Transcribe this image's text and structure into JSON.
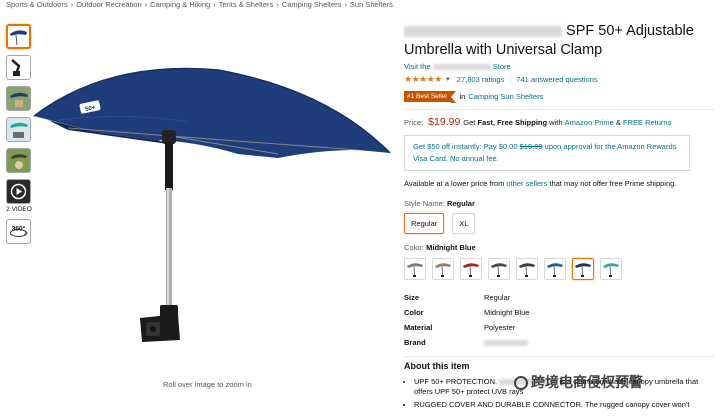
{
  "breadcrumb": [
    "Sports & Outdoors",
    "Outdoor Recreation",
    "Camping & Hiking",
    "Tents & Shelters",
    "Camping Shelters",
    "Sun Shelters"
  ],
  "breadcrumb_sep": "›",
  "thumbnails": {
    "video_label": "2 VIDEO",
    "spin_label": "360°"
  },
  "main_image": {
    "roll_over": "Roll over image to zoom in",
    "badge": "50+"
  },
  "product": {
    "title_visible": "SPF 50+ Adjustable Umbrella with Universal Clamp",
    "store_prefix": "Visit the",
    "store_suffix": "Store",
    "stars": "★★★★★",
    "ratings": "27,803 ratings",
    "answered": "741 answered questions",
    "best_seller_badge": "#1 Best Seller",
    "best_seller_in": "in",
    "best_seller_category": "Camping Sun Shelters"
  },
  "price": {
    "label": "Price:",
    "value": "$19.99",
    "get": "Get",
    "fast_free": "Fast, Free Shipping",
    "with": "with",
    "prime": "Amazon Prime",
    "amp": "&",
    "free_returns": "FREE Returns"
  },
  "promo": {
    "text_a": "Get $50 off instantly: Pay $0.00",
    "old_price": "$19.99",
    "text_b": "upon approval for the Amazon Rewards Visa Card. No annual fee."
  },
  "availability": {
    "text_a": "Available at a lower price from",
    "link": "other sellers",
    "text_b": "that may not offer free Prime shipping."
  },
  "style": {
    "label": "Style Name:",
    "selected": "Regular",
    "options": [
      "Regular",
      "XL"
    ]
  },
  "color": {
    "label": "Color:",
    "selected": "Midnight Blue",
    "swatches": [
      "#7b7d80",
      "#9a7a66",
      "#a3262a",
      "#4a4c50",
      "#3a3c40",
      "#2f5e8c",
      "#1c2f5e",
      "#3aa8a4"
    ]
  },
  "specs": [
    {
      "key": "Size",
      "value": "Regular"
    },
    {
      "key": "Color",
      "value": "Midnight Blue"
    },
    {
      "key": "Material",
      "value": "Polyester"
    },
    {
      "key": "Brand",
      "value": ""
    }
  ],
  "about": {
    "title": "About this item",
    "b1_a": "UPF 50+ PROTECTION.",
    "b1_b": "is a clamp-on shade canopy umbrella that offers UPF 50+ protect",
    "b1_c": "UVB rays",
    "b2": "RUGGED COVER AND DURABLE CONNECTOR. The rugged canopy cover won't"
  },
  "watermark": "跨境电商侵权预警",
  "colors": {
    "accent": "#e77600",
    "link": "#007185",
    "price": "#b12704",
    "badge": "#c45500",
    "umbrella": "#1f3d7a"
  }
}
